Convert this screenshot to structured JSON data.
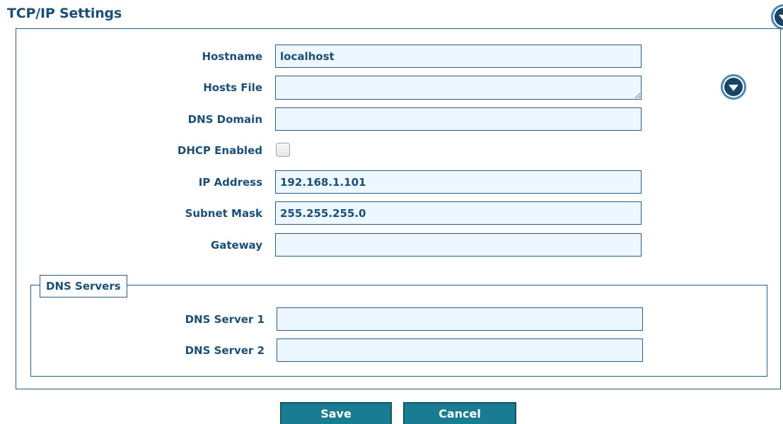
{
  "page": {
    "title": "TCP/IP Settings"
  },
  "form": {
    "hostname": {
      "label": "Hostname",
      "value": "localhost"
    },
    "hosts_file": {
      "label": "Hosts File",
      "value": ""
    },
    "dns_domain": {
      "label": "DNS Domain",
      "value": ""
    },
    "dhcp_enabled": {
      "label": "DHCP Enabled",
      "checked": false
    },
    "ip_address": {
      "label": "IP Address",
      "value": "192.168.1.101"
    },
    "subnet_mask": {
      "label": "Subnet Mask",
      "value": "255.255.255.0"
    },
    "gateway": {
      "label": "Gateway",
      "value": ""
    }
  },
  "dns_servers": {
    "legend": "DNS Servers",
    "server1": {
      "label": "DNS Server 1",
      "value": ""
    },
    "server2": {
      "label": "DNS Server 2",
      "value": ""
    }
  },
  "buttons": {
    "save": "Save",
    "cancel": "Cancel"
  },
  "icons": {
    "section_toggle": "chevron-down-icon",
    "hosts_file_toggle": "chevron-down-icon"
  },
  "colors": {
    "text": "#1b4f77",
    "border": "#2a5c86",
    "field_bg": "#ecf7ff",
    "button_bg": "#1a7c93",
    "button_text": "#ffffff",
    "icon_bg": "#1a4466"
  }
}
